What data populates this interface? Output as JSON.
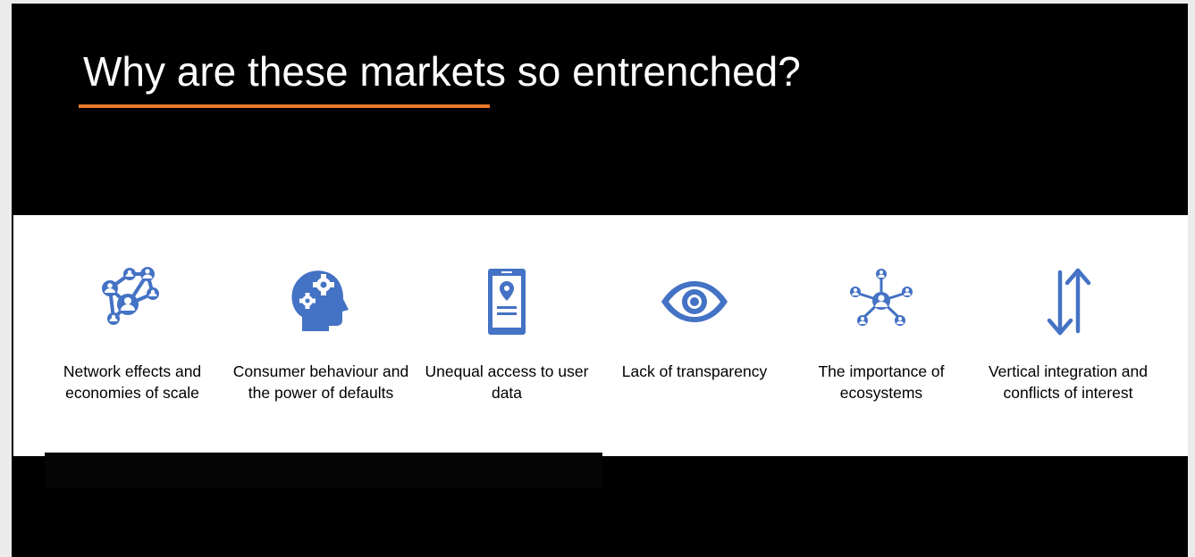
{
  "slide": {
    "title": "Why are these markets so entrenched?",
    "accent_color": "#e8772e",
    "icon_color": "#4472c4",
    "items": [
      {
        "icon": "network-icon",
        "label": "Network effects and economies of scale"
      },
      {
        "icon": "head-gears-icon",
        "label": "Consumer behaviour and the power of defaults"
      },
      {
        "icon": "phone-location-icon",
        "label": "Unequal access to user data"
      },
      {
        "icon": "eye-icon",
        "label": "Lack of transparency"
      },
      {
        "icon": "hub-network-icon",
        "label": "The importance of ecosystems"
      },
      {
        "icon": "up-down-arrows-icon",
        "label": "Vertical integration and conflicts of interest"
      }
    ]
  }
}
